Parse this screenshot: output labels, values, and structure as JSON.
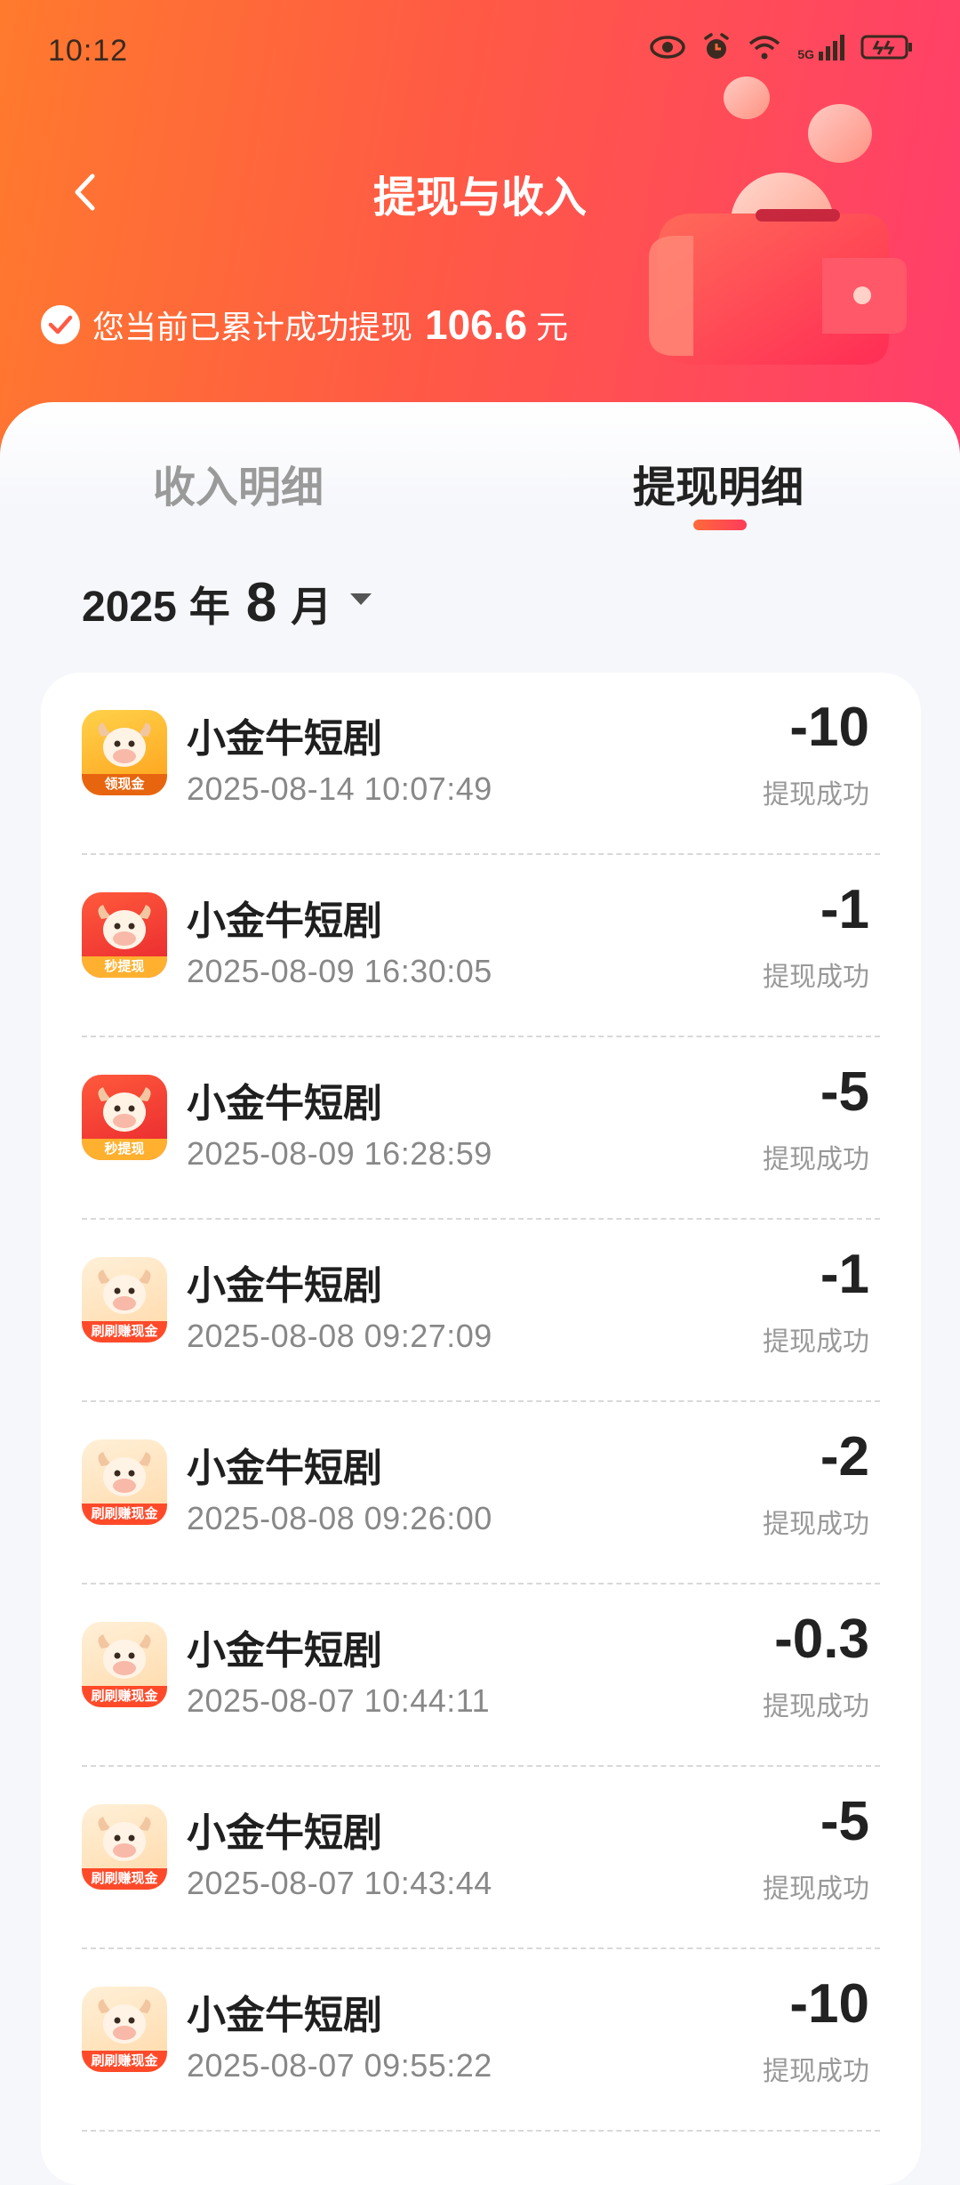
{
  "status_bar": {
    "time": "10:12",
    "network": "5G"
  },
  "header": {
    "title": "提现与收入",
    "total_prefix": "您当前已累计成功提现",
    "total_amount": "106.6",
    "total_unit": "元"
  },
  "tabs": [
    {
      "label": "收入明细",
      "active": false
    },
    {
      "label": "提现明细",
      "active": true
    }
  ],
  "month_selector": {
    "year": "2025",
    "year_label": "年",
    "month": "8",
    "month_label": "月"
  },
  "records": [
    {
      "name": "小金牛短剧",
      "time": "2025-08-14 10:07:49",
      "amount": "-10",
      "status": "提现成功",
      "icon_label": "领现金"
    },
    {
      "name": "小金牛短剧",
      "time": "2025-08-09 16:30:05",
      "amount": "-1",
      "status": "提现成功",
      "icon_label": "秒提现"
    },
    {
      "name": "小金牛短剧",
      "time": "2025-08-09 16:28:59",
      "amount": "-5",
      "status": "提现成功",
      "icon_label": "秒提现"
    },
    {
      "name": "小金牛短剧",
      "time": "2025-08-08 09:27:09",
      "amount": "-1",
      "status": "提现成功",
      "icon_label": "刷刷赚现金"
    },
    {
      "name": "小金牛短剧",
      "time": "2025-08-08 09:26:00",
      "amount": "-2",
      "status": "提现成功",
      "icon_label": "刷刷赚现金"
    },
    {
      "name": "小金牛短剧",
      "time": "2025-08-07 10:44:11",
      "amount": "-0.3",
      "status": "提现成功",
      "icon_label": "刷刷赚现金"
    },
    {
      "name": "小金牛短剧",
      "time": "2025-08-07 10:43:44",
      "amount": "-5",
      "status": "提现成功",
      "icon_label": "刷刷赚现金"
    },
    {
      "name": "小金牛短剧",
      "time": "2025-08-07 09:55:22",
      "amount": "-10",
      "status": "提现成功",
      "icon_label": "刷刷赚现金"
    }
  ],
  "colors": {
    "header_start": "#ff7a2d",
    "header_end": "#ff3d6c",
    "accent": "#ff4d4f"
  }
}
